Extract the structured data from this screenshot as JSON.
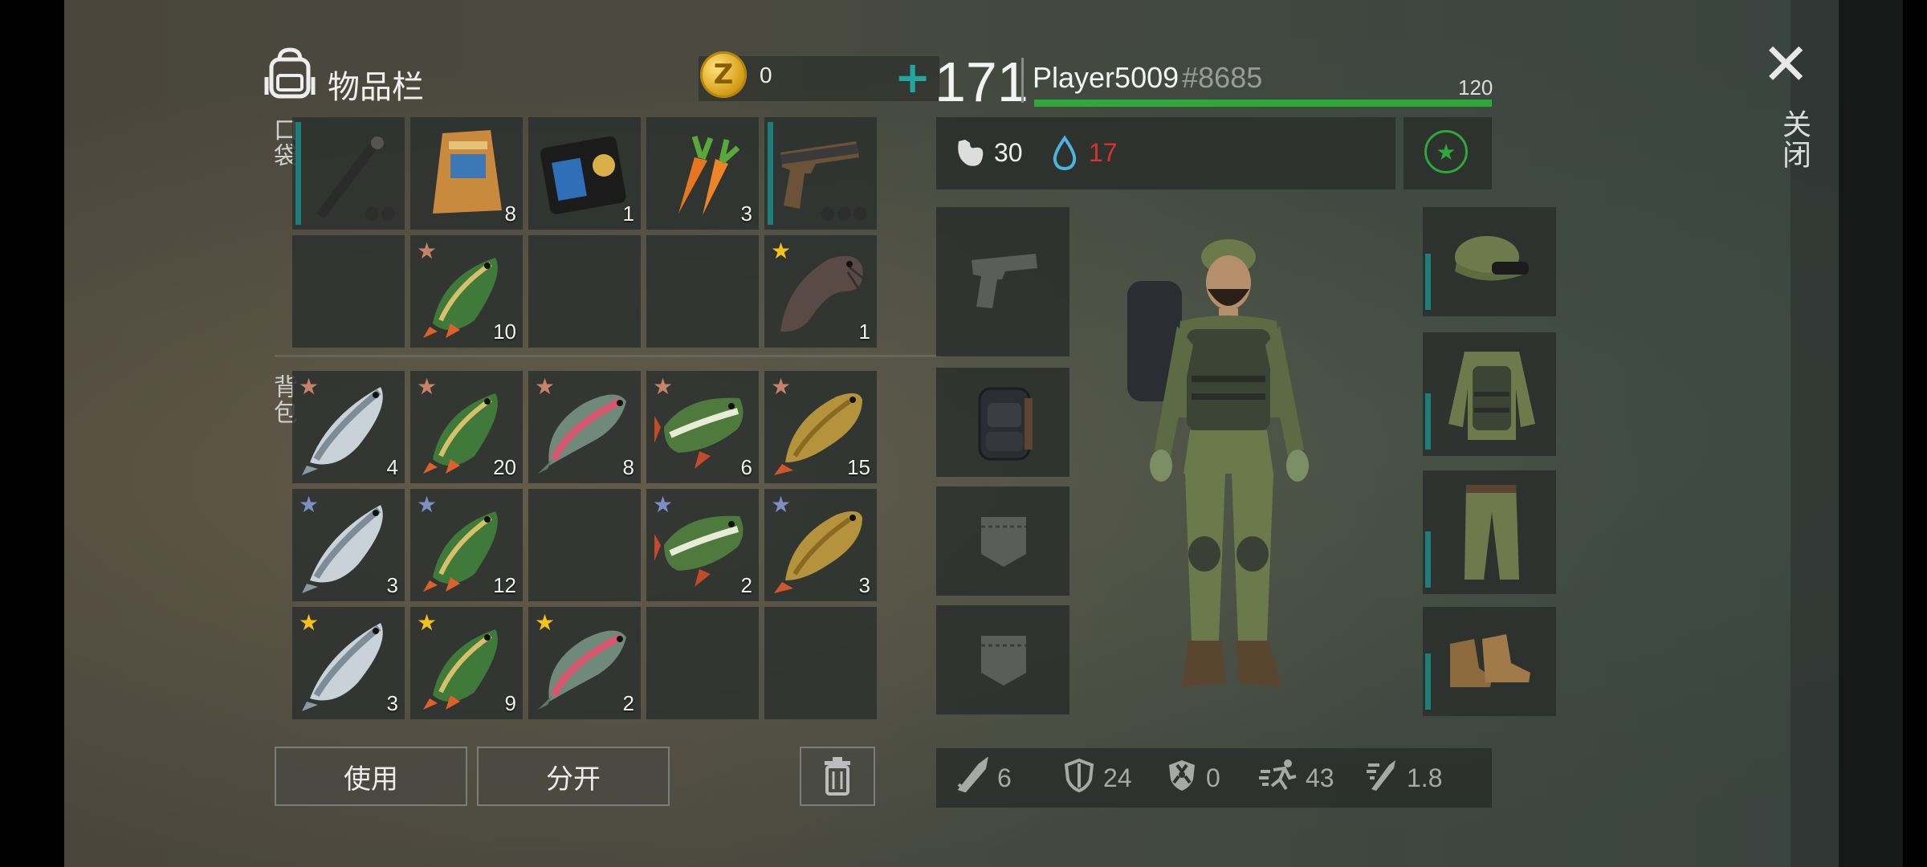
{
  "inventory": {
    "title": "物品栏",
    "coins": "0",
    "coin_symbol": "Z",
    "pocket_label": "口袋",
    "backpack_label": "背包"
  },
  "pocket_items": [
    {
      "icon": "crowbar-icon",
      "count": "",
      "star": "",
      "bar": true,
      "dots": "●●"
    },
    {
      "icon": "bait-bag-icon",
      "count": "8",
      "star": ""
    },
    {
      "icon": "police-badge-wallet-icon",
      "count": "1",
      "star": ""
    },
    {
      "icon": "carrot-icon",
      "count": "3",
      "star": ""
    },
    {
      "icon": "flare-gun-icon",
      "count": "",
      "star": "",
      "bar": true,
      "dots": "●●●"
    },
    {
      "icon": "",
      "count": "",
      "star": ""
    },
    {
      "icon": "perch-fish-icon",
      "count": "10",
      "star": "bronze"
    },
    {
      "icon": "",
      "count": "",
      "star": ""
    },
    {
      "icon": "",
      "count": "",
      "star": ""
    },
    {
      "icon": "catfish-icon",
      "count": "1",
      "star": "gold"
    }
  ],
  "backpack_items": [
    {
      "icon": "salmon-icon",
      "count": "4",
      "star": "bronze"
    },
    {
      "icon": "perch-fish-icon",
      "count": "20",
      "star": "bronze"
    },
    {
      "icon": "trout-icon",
      "count": "8",
      "star": "bronze"
    },
    {
      "icon": "pike-icon",
      "count": "6",
      "star": "bronze"
    },
    {
      "icon": "carp-icon",
      "count": "15",
      "star": "bronze"
    },
    {
      "icon": "salmon-icon",
      "count": "3",
      "star": "silver"
    },
    {
      "icon": "perch-fish-icon",
      "count": "12",
      "star": "silver"
    },
    {
      "icon": "",
      "count": "",
      "star": ""
    },
    {
      "icon": "pike-icon",
      "count": "2",
      "star": "silver"
    },
    {
      "icon": "carp-icon",
      "count": "3",
      "star": "silver"
    },
    {
      "icon": "salmon-icon",
      "count": "3",
      "star": "gold"
    },
    {
      "icon": "perch-fish-icon",
      "count": "9",
      "star": "gold"
    },
    {
      "icon": "trout-icon",
      "count": "2",
      "star": "gold"
    },
    {
      "icon": "",
      "count": "",
      "star": ""
    },
    {
      "icon": "",
      "count": "",
      "star": ""
    }
  ],
  "buttons": {
    "use": "使用",
    "split": "分开"
  },
  "player": {
    "level": "171",
    "name": "Player5009",
    "tag": "#8685",
    "hp": "120",
    "hunger": "30",
    "thirst": "17"
  },
  "stats": [
    {
      "icon": "attack-knife-icon",
      "value": "6"
    },
    {
      "icon": "armor-shield-icon",
      "value": "24"
    },
    {
      "icon": "radiation-shield-icon",
      "value": "0"
    },
    {
      "icon": "speed-runner-icon",
      "value": "43"
    },
    {
      "icon": "stealth-icon",
      "value": "1.8"
    }
  ],
  "close_label": "关闭",
  "colors": {
    "accent_teal": "#1e7d78",
    "hp_green": "#2fa83a",
    "thirst_red": "#d8322c",
    "star_gold": "#f4c21a",
    "star_bronze": "#c8826a",
    "star_silver": "#7d8fc4"
  }
}
